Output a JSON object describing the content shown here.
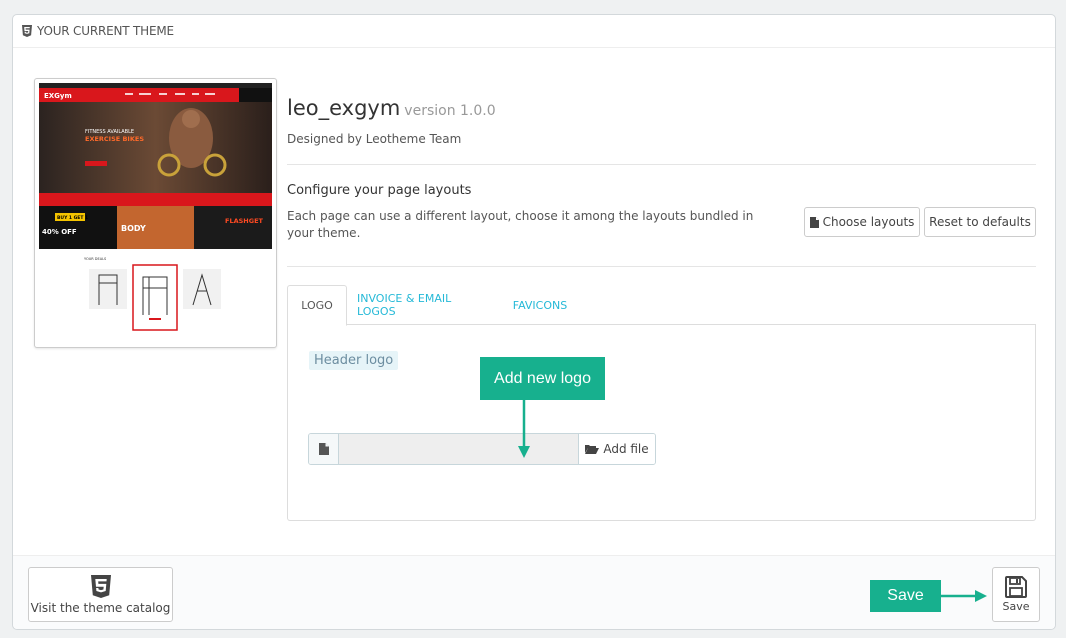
{
  "panel": {
    "heading": "YOUR CURRENT THEME"
  },
  "theme": {
    "name": "leo_exgym",
    "version": "version 1.0.0",
    "designed_by": "Designed by Leotheme Team"
  },
  "preview": {
    "brand": "EXGym",
    "hero_line1": "FITNESS AVAILABLE",
    "hero_line2": "EXERCISE BIKES",
    "promo1_line1": "BUY 1 GET 1",
    "promo1_line2": "40% OFF",
    "promo2": "BODY",
    "promo3": "FLASHGET",
    "section_title": "YOUR DEALS"
  },
  "layouts": {
    "title": "Configure your page layouts",
    "description": "Each page can use a different layout, choose it among the layouts bundled in your theme.",
    "choose_label": "Choose layouts",
    "reset_label": "Reset to defaults"
  },
  "tabs": [
    {
      "label": "LOGO",
      "active": true
    },
    {
      "label": "INVOICE & EMAIL LOGOS",
      "active": false
    },
    {
      "label": "FAVICONS",
      "active": false
    }
  ],
  "logo_tab": {
    "header_logo_label": "Header logo",
    "file_input_value": "",
    "add_file_label": "Add file"
  },
  "callouts": {
    "add_logo": "Add new logo",
    "save": "Save"
  },
  "footer": {
    "catalog_label": "Visit the theme catalog",
    "save_label": "Save"
  },
  "colors": {
    "accent_link": "#25b9d7",
    "callout": "#17b08e",
    "theme_red": "#d9171c"
  }
}
